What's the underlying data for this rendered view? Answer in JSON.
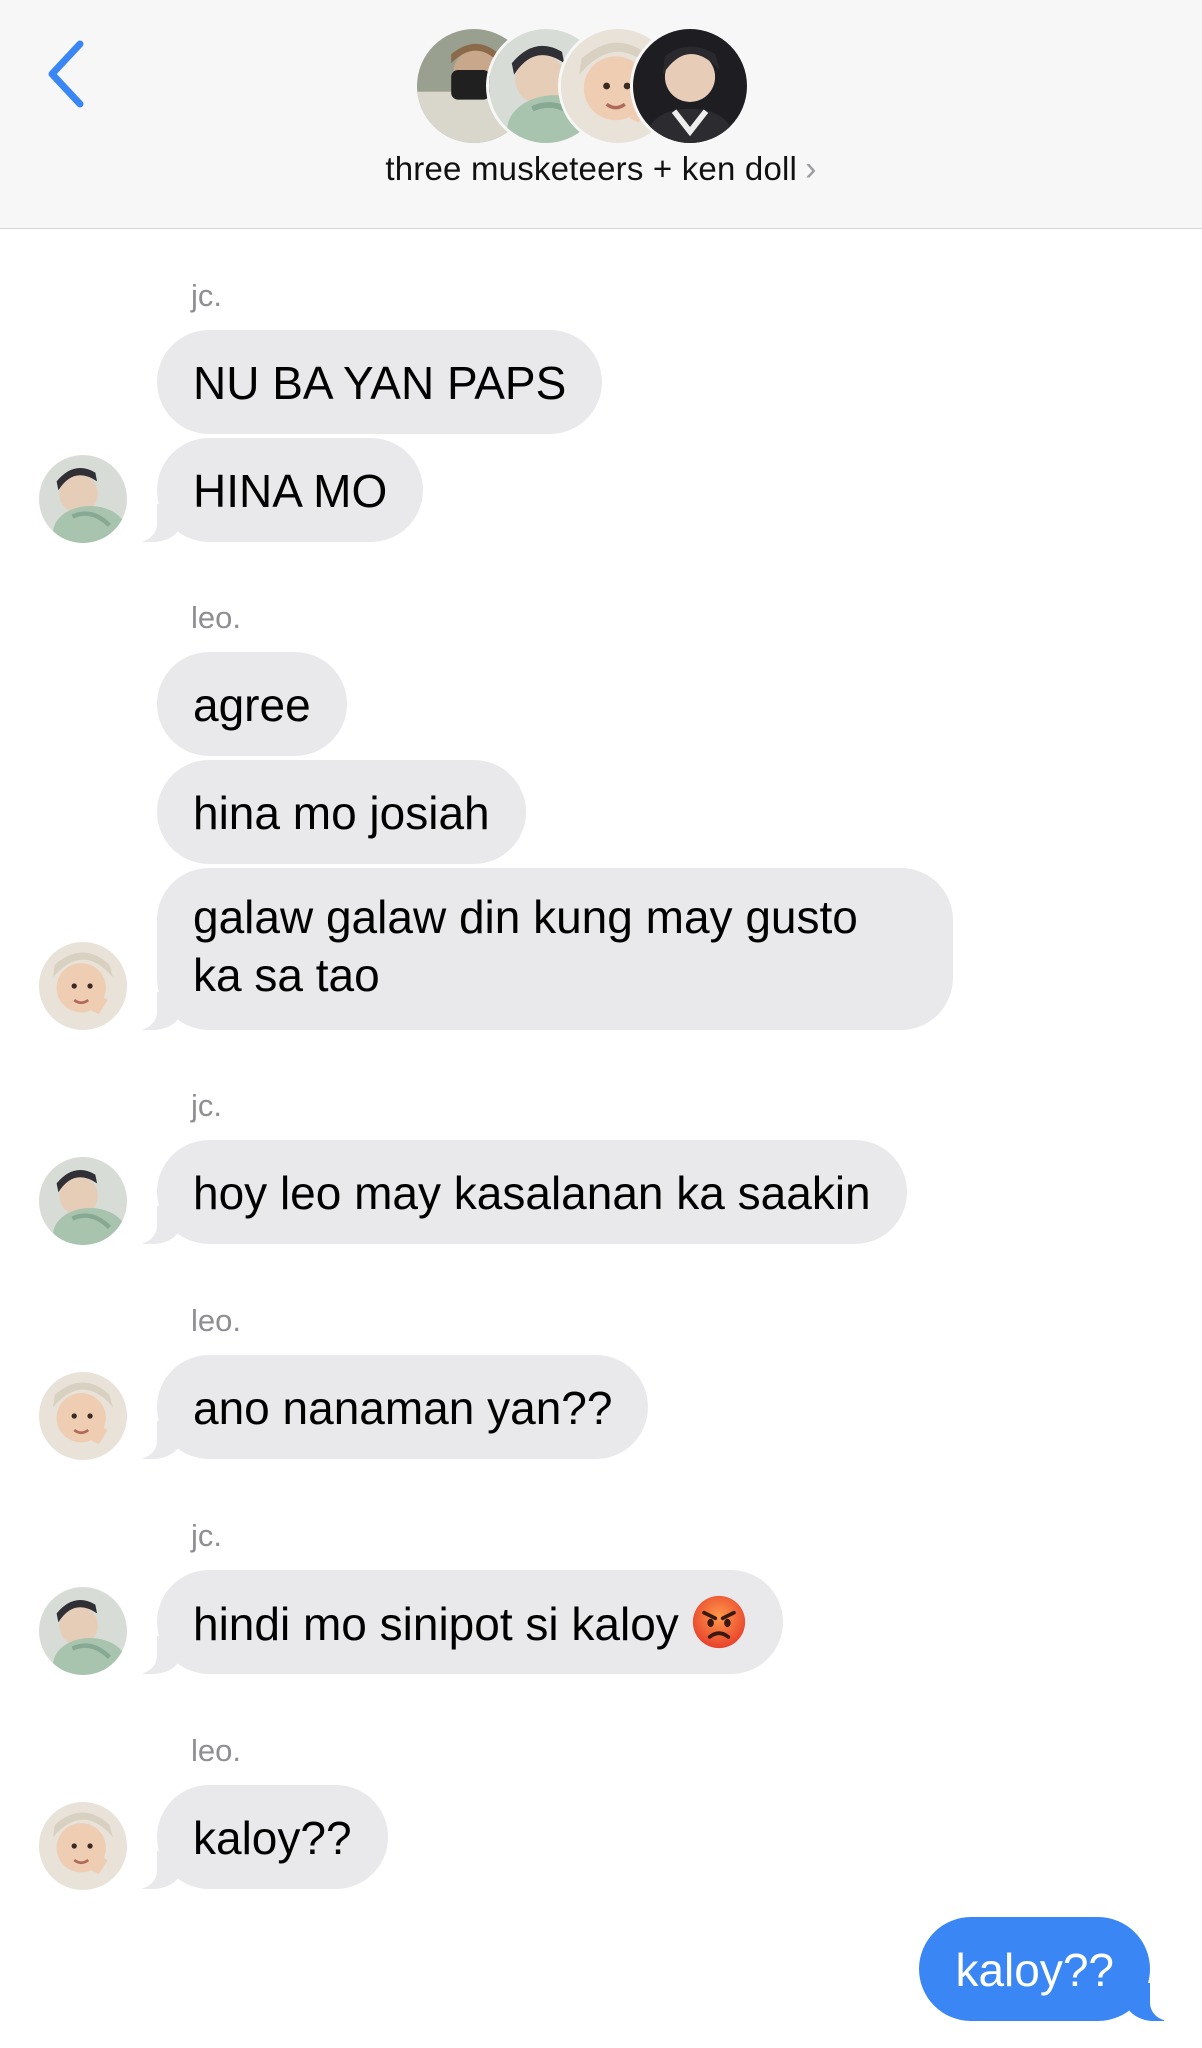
{
  "header": {
    "title": "three musketeers + ken doll",
    "chevron": "›",
    "back_icon": "chevron-left-icon",
    "accent_color": "#3a86f5"
  },
  "messages": [
    {
      "sender": "jc.",
      "texts": [
        "NU BA YAN PAPS",
        "HINA MO"
      ]
    },
    {
      "sender": "leo.",
      "texts": [
        "agree",
        "hina mo josiah",
        "galaw galaw din kung may gusto ka sa tao"
      ]
    },
    {
      "sender": "jc.",
      "texts": [
        "hoy leo may kasalanan ka saakin"
      ]
    },
    {
      "sender": "leo.",
      "texts": [
        "ano nanaman yan??"
      ]
    },
    {
      "sender": "jc.",
      "texts": [
        "hindi mo sinipot si kaloy"
      ],
      "emoji": "angry-face-emoji"
    },
    {
      "sender": "leo.",
      "texts": [
        "kaloy??"
      ]
    }
  ],
  "outgoing": {
    "text": "kaloy??",
    "color": "#3a86f5"
  },
  "colors": {
    "incoming_bubble": "#e9e9eb",
    "outgoing_bubble": "#3a86f5",
    "sender_label": "#8e8e93"
  }
}
